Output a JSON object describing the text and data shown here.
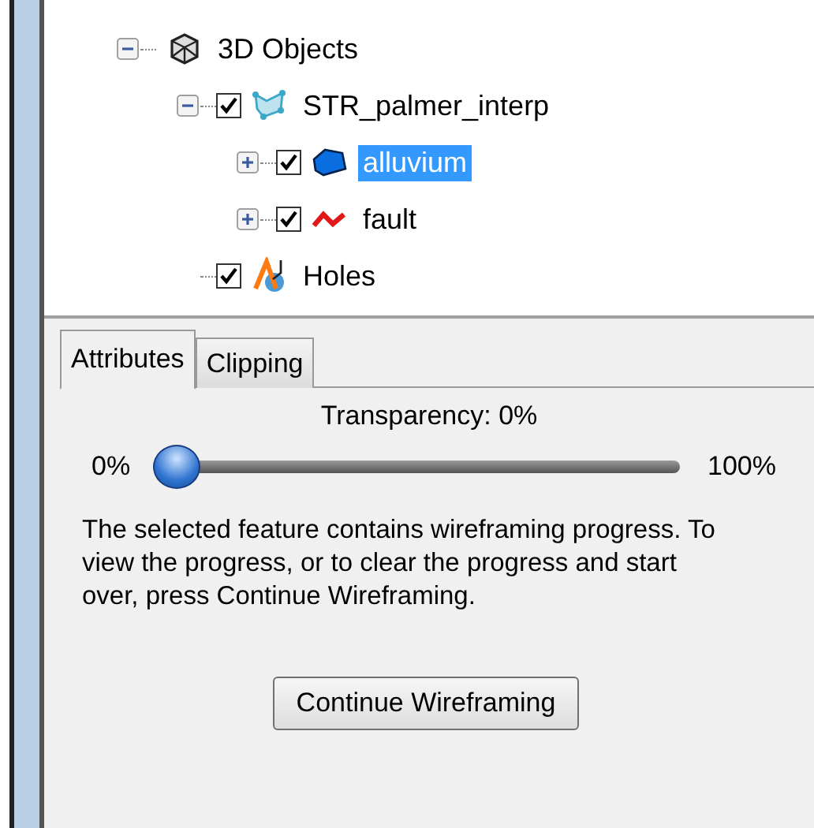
{
  "tree": [
    {
      "label": "3D Objects",
      "kind": "objects",
      "expanded": true,
      "children": [
        {
          "label": "STR_palmer_interp",
          "kind": "surface",
          "checked": true,
          "expanded": true,
          "children": [
            {
              "label": "alluvium",
              "kind": "polygon",
              "checked": true,
              "expanded": false,
              "selected": true
            },
            {
              "label": "fault",
              "kind": "fault",
              "checked": true,
              "expanded": false,
              "selected": false
            }
          ],
          "selected": false
        },
        {
          "label": "Holes",
          "kind": "holes",
          "checked": true,
          "selected": false
        }
      ],
      "selected": false
    }
  ],
  "tabs": [
    {
      "label": "Attributes",
      "selected": true
    },
    {
      "label": "Clipping",
      "selected": false
    }
  ],
  "transparency": {
    "label": "Transparency: 0%",
    "min_label": "0%",
    "max_label": "100%",
    "level": 0
  },
  "message": "The selected feature contains wireframing progress. To view the progress, or to clear the progress and start over, press Continue Wireframing.",
  "button": "Continue Wireframing"
}
